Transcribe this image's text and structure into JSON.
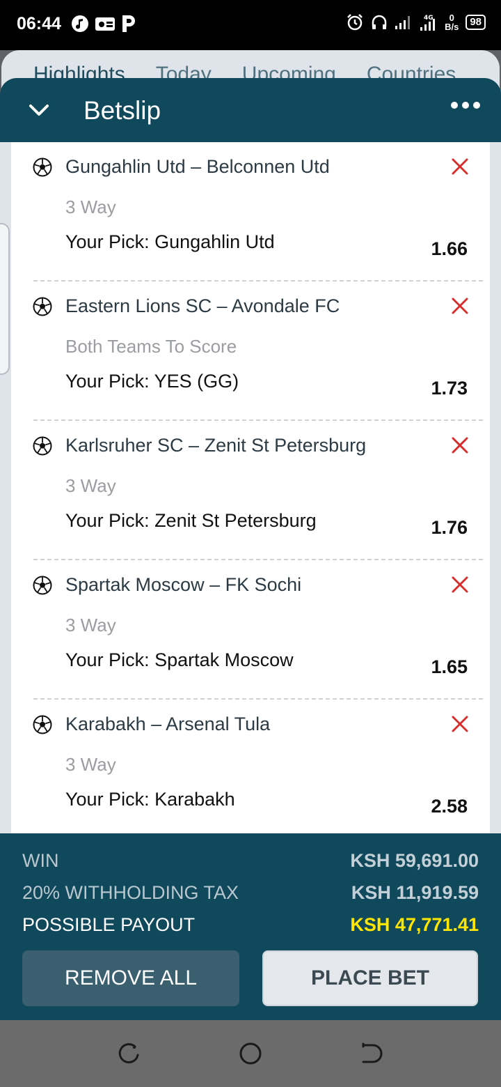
{
  "status_bar": {
    "time": "06:44",
    "icons_left": [
      "music-note-icon",
      "radio-icon",
      "p-app-icon"
    ],
    "icons_right": [
      "alarm-icon",
      "headphones-icon",
      "signal-icon",
      "signal-4g-icon"
    ],
    "net_speed_value": "0",
    "net_speed_unit": "B/s",
    "battery": "98"
  },
  "background_tabs": [
    "Highlights",
    "Today",
    "Upcoming",
    "Countries"
  ],
  "betslip": {
    "title": "Betslip",
    "bets": [
      {
        "match": "Gungahlin Utd – Belconnen Utd",
        "market": "3 Way",
        "pick": "Your Pick: Gungahlin Utd",
        "odds": "1.66"
      },
      {
        "match": "Eastern Lions SC – Avondale FC",
        "market": "Both Teams To Score",
        "pick": "Your Pick: YES (GG)",
        "odds": "1.73"
      },
      {
        "match": "Karlsruher SC – Zenit St Petersburg",
        "market": "3 Way",
        "pick": "Your Pick: Zenit St Petersburg",
        "odds": "1.76"
      },
      {
        "match": "Spartak Moscow – FK Sochi",
        "market": "3 Way",
        "pick": "Your Pick: Spartak Moscow",
        "odds": "1.65"
      },
      {
        "match": "Karabakh – Arsenal Tula",
        "market": "3 Way",
        "pick": "Your Pick: Karabakh",
        "odds": "2.58"
      }
    ]
  },
  "summary": {
    "win_label": "WIN",
    "win_value": "KSH 59,691.00",
    "tax_label": "20% WITHHOLDING TAX",
    "tax_value": "KSH 11,919.59",
    "payout_label": "POSSIBLE PAYOUT",
    "payout_value": "KSH 47,771.41",
    "payout_color": "#ffe500"
  },
  "buttons": {
    "remove_all": "REMOVE ALL",
    "place_bet": "PLACE BET"
  },
  "colors": {
    "header_bg": "#11495c",
    "remove_x": "#d32f2f"
  }
}
